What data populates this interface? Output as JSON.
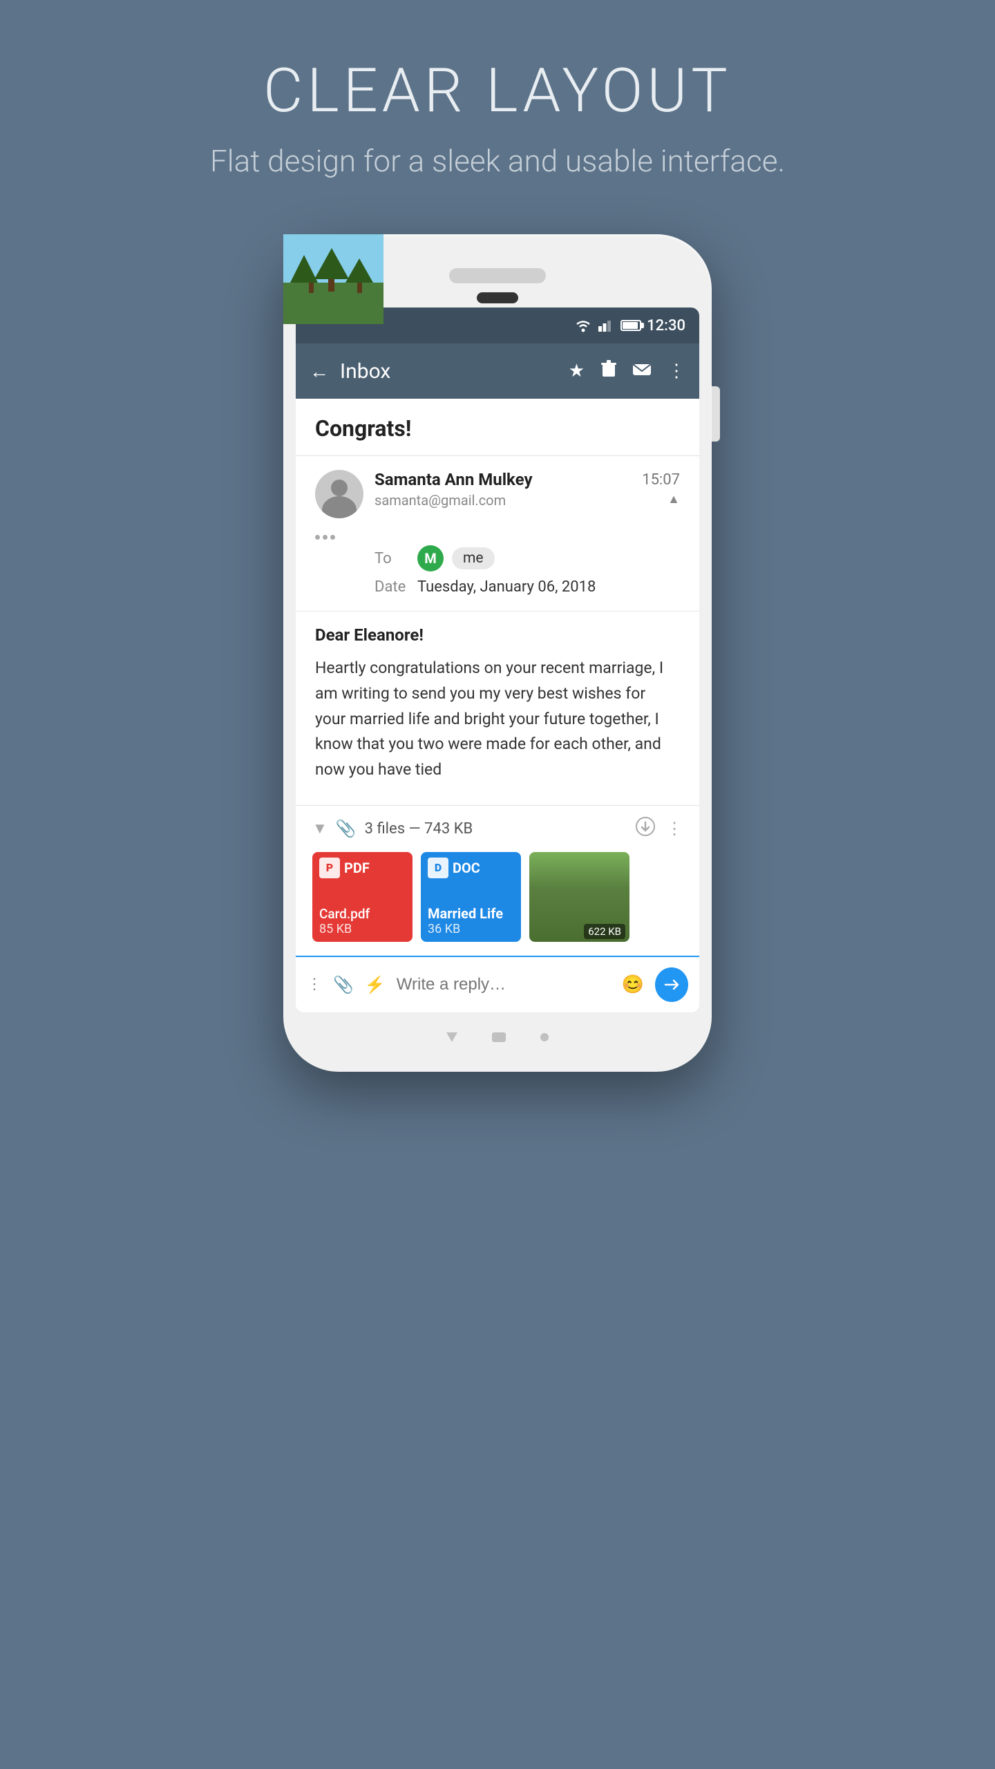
{
  "page": {
    "title": "CLEAR LAYOUT",
    "subtitle": "Flat design for a sleek and usable interface."
  },
  "status_bar": {
    "time": "12:30"
  },
  "app_bar": {
    "back_label": "←",
    "title": "Inbox",
    "star_icon": "★",
    "delete_icon": "🗑",
    "email_icon": "✉",
    "more_icon": "⋮"
  },
  "email": {
    "subject": "Congrats!",
    "sender": {
      "name": "Samanta Ann Mulkey",
      "email": "samanta@gmail.com",
      "time": "15:07"
    },
    "to": {
      "badge": "M",
      "name": "me"
    },
    "date": {
      "label": "Date",
      "value": "Tuesday, January 06, 2018"
    },
    "greeting": "Dear Eleanore!",
    "body": "Heartly congratulations on your recent marriage, I am writing to send you my very best wishes for your married life and bright your future together, I know that you two were made for each other, and now you have tied"
  },
  "attachments": {
    "summary": "3 files — 743 KB",
    "files": [
      {
        "type": "PDF",
        "name": "Card.pdf",
        "size": "85 KB",
        "color": "#e53935"
      },
      {
        "type": "DOC",
        "name": "Married Life",
        "size": "36 KB",
        "color": "#1e88e5"
      },
      {
        "type": "IMG",
        "name": "",
        "size": "622 KB",
        "color": "#5a8040"
      }
    ]
  },
  "reply": {
    "placeholder": "Write a reply…"
  }
}
